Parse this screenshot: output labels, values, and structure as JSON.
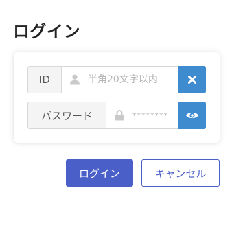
{
  "title": "ログイン",
  "form": {
    "id_label": "ID",
    "id_placeholder": "半角20文字以内",
    "id_value": "",
    "password_label": "パスワード",
    "password_placeholder": "********",
    "password_value": "",
    "clear_icon": "close-icon",
    "show_password_icon": "eye-icon",
    "user_icon": "user-icon",
    "lock_icon": "lock-icon"
  },
  "actions": {
    "login_label": "ログイン",
    "cancel_label": "キャンセル"
  },
  "colors": {
    "primary": "#4a5fc7",
    "icon_button": "#3e8bd0"
  }
}
